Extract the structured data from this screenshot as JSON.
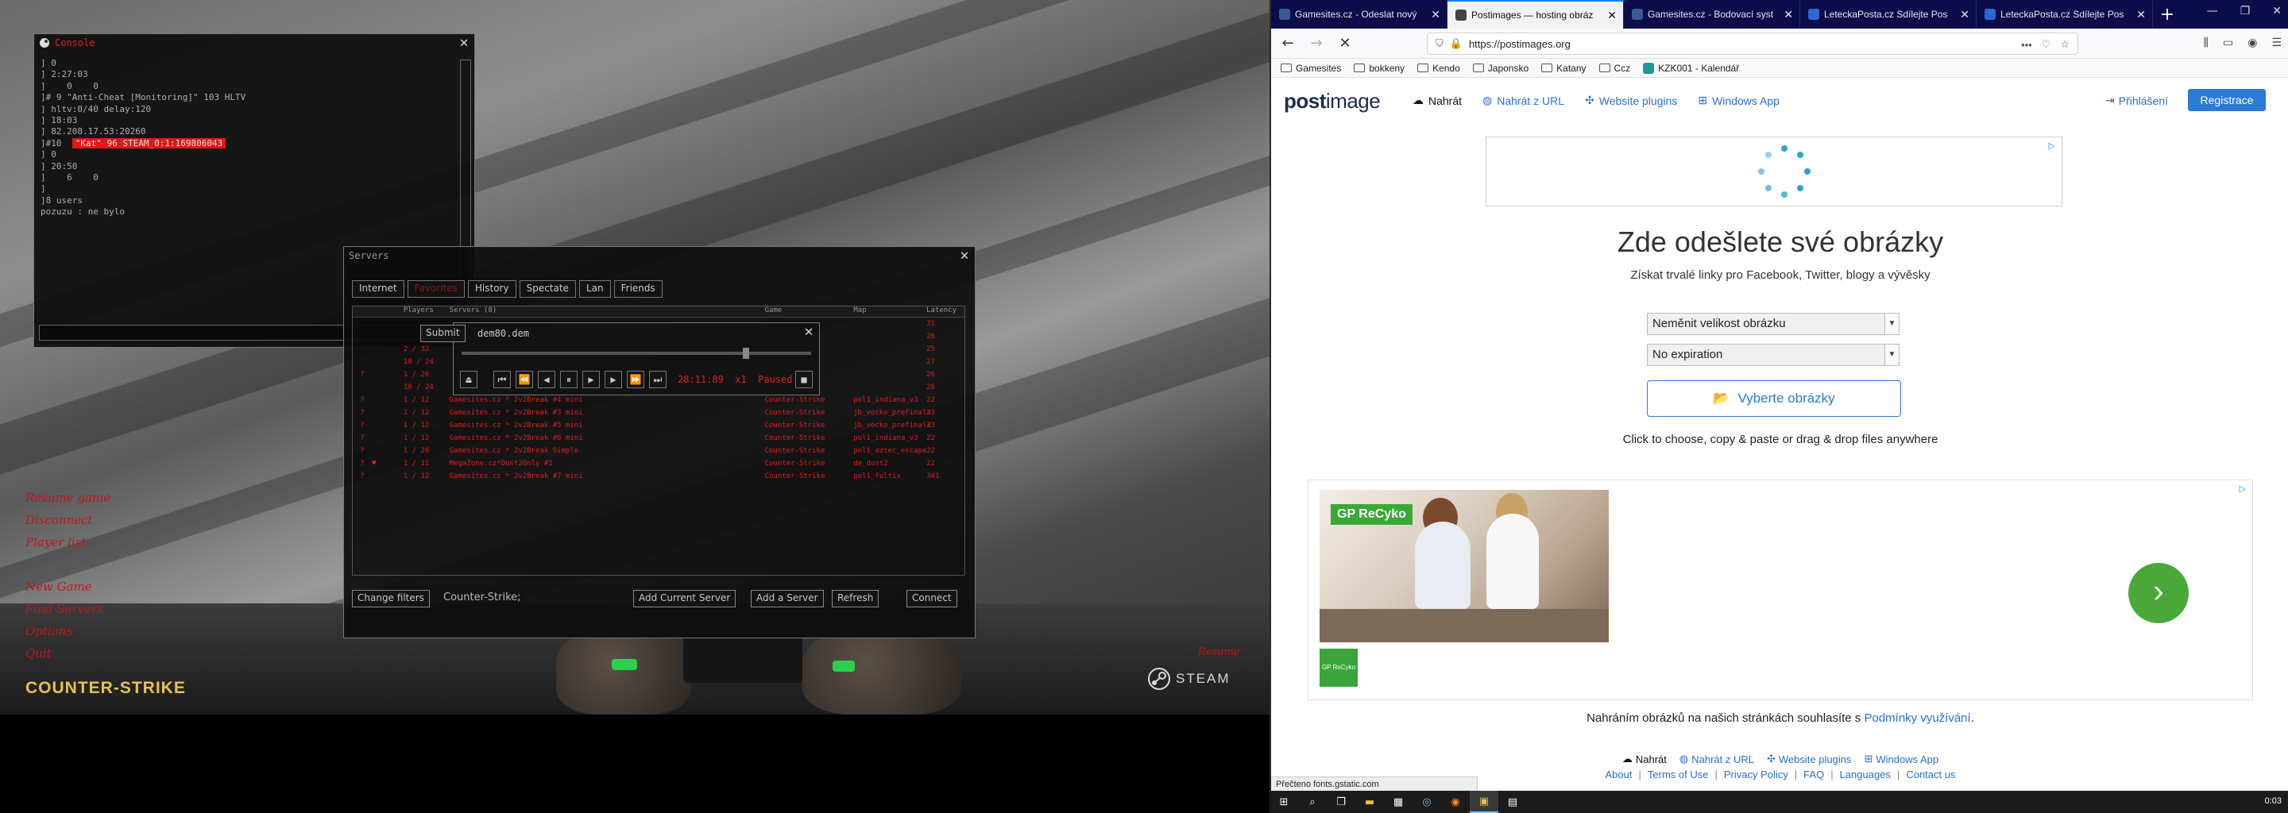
{
  "game": {
    "menu_items": [
      "Resume game",
      "Disconnect",
      "Player list",
      "New Game",
      "Find Servers",
      "Options",
      "Quit"
    ],
    "logo_text": "COUNTER-STRIKE",
    "steam_text": "STEAM",
    "steam_red_text": "Resume",
    "console": {
      "title": "Console",
      "lines": [
        "] 0",
        "] 2:27:03",
        "]    0    0",
        "",
        "]# 9 \"Anti-Cheat [Monitoring]\" 103 HLTV",
        "] hltv:0/40 delay:120",
        "] 18:03",
        "] 82.208.17.53:20260",
        "",
        "]#10  ",
        "] 0",
        "] 20:50",
        "]    6    0",
        "]",
        "]8 users",
        "",
        "pozuzu : ne bylo"
      ],
      "highlight": "\"Kat\" 96 STEAM_0:1:169806043",
      "submit_label": "Submit"
    },
    "servers": {
      "title": "Servers",
      "tabs": [
        "Internet",
        "Favorites",
        "History",
        "Spectate",
        "Lan",
        "Friends"
      ],
      "headers": [
        "",
        "",
        "Players",
        "Servers (8)",
        "Game",
        "Map",
        "Latency"
      ],
      "rows": [
        [
          "",
          "",
          "",
          "",
          "",
          "",
          "31"
        ],
        [
          "",
          "",
          "",
          "",
          "",
          "",
          "26"
        ],
        [
          "",
          "",
          "2 / 32",
          "",
          "",
          "",
          "25"
        ],
        [
          "",
          "",
          "10 / 24",
          "",
          "",
          "",
          "27"
        ],
        [
          "?",
          "",
          "1 / 26",
          "",
          "",
          "",
          "26"
        ],
        [
          "",
          "",
          "10 / 24",
          "",
          "",
          "",
          "26"
        ],
        [
          "?",
          "",
          "1 / 12",
          "Gamesites.cz * 2v2Break #4 mini",
          "Counter-Strike",
          "pol1_indiana_v3",
          "22"
        ],
        [
          "?",
          "",
          "1 / 12",
          "Gamesites.cz * 2v2Break #3 mini",
          "Counter-Strike",
          "jb_vocko_prefinal3",
          "23"
        ],
        [
          "?",
          "",
          "1 / 12",
          "Gamesites.cz * 2v2Break #5 mini",
          "Counter-Strike",
          "jb_vocko_prefinal3",
          "23"
        ],
        [
          "?",
          "",
          "1 / 12",
          "Gamesites.cz * 2v2Break #6 mini",
          "Counter-Strike",
          "pol1_indiana_v3",
          "22"
        ],
        [
          "?",
          "",
          "1 / 20",
          "Gamesites.cz * 2v2Break Simple",
          "Counter-Strike",
          "pol1_aztec_escape",
          "22"
        ],
        [
          "?",
          "♥",
          "1 / 11",
          "MegaZone.cz*Dust2Only #1",
          "Counter-Strike",
          "de_dust2",
          "22"
        ],
        [
          "?",
          "",
          "1 / 12",
          "Gamesites.cz * 2v2Break #7 mini",
          "Counter-Strike",
          "pol1_fultix",
          "341"
        ]
      ],
      "change_filters": "Change filters",
      "filter_text": "Counter-Strike;",
      "add_current": "Add Current Server",
      "add_server": "Add a Server",
      "refresh": "Refresh",
      "connect": "Connect"
    },
    "demo": {
      "file": "dem80.dem",
      "time": "28:11:89",
      "speed": "x1",
      "state": "Paused",
      "progress": 0.82
    }
  },
  "browser": {
    "tabs": [
      {
        "label": "Gamesites.cz - Odeslat nový",
        "color": "#3b5998"
      },
      {
        "label": "Postimages — hosting obráz",
        "color": "#1a1a1a",
        "active": true
      },
      {
        "label": "Gamesites.cz - Bodovací syst",
        "color": "#3b5998"
      },
      {
        "label": "LeteckaPosta.cz Sdílejte Pos",
        "color": "#2a6ad4"
      },
      {
        "label": "LeteckaPosta.cz Sdílejte Pos",
        "color": "#2a6ad4"
      }
    ],
    "url": "https://postimages.org",
    "bookmarks": [
      "Gamesites",
      "bokkeny",
      "Kendo",
      "Japonsko",
      "Katany",
      "Ccz",
      "KZK001 - Kalendář"
    ],
    "status": "Přečteno fonts.gstatic.com"
  },
  "page": {
    "logo_main": "post",
    "logo_accent": "image",
    "nav": [
      "Nahrát",
      "Nahrát z URL",
      "Website plugins",
      "Windows App"
    ],
    "login": "Přihlášení",
    "register": "Registrace",
    "title": "Zde odešlete své obrázky",
    "subtitle": "Získat trvalé linky pro Facebook, Twitter, blogy a vývěsky",
    "resize_select": "Neměnit velikost obrázku",
    "expiry_select": "No expiration",
    "choose_button": "Vyberte obrázky",
    "hint": "Click to choose, copy & paste or drag & drop files anywhere",
    "ad_brand": "ReCyko",
    "ad_brand_prefix": "GP",
    "ad_small": "GP ReCyko",
    "terms_prefix": "Nahráním obrázků na našich stránkách souhlasíte s",
    "terms_link": "Podmínky využívání",
    "terms_suffix": ".",
    "footer_nav": [
      "Nahrát",
      "Nahrát z URL",
      "Website plugins",
      "Windows App"
    ],
    "footer_links": [
      "About",
      "Terms of Use",
      "Privacy Policy",
      "FAQ",
      "Languages",
      "Contact us"
    ]
  },
  "taskbar": {
    "clock": "0:03"
  },
  "colors": {
    "cs_red": "#c0161a",
    "pi_blue": "#2b7bd6",
    "ff_tabstrip": "#0c0c4a"
  }
}
